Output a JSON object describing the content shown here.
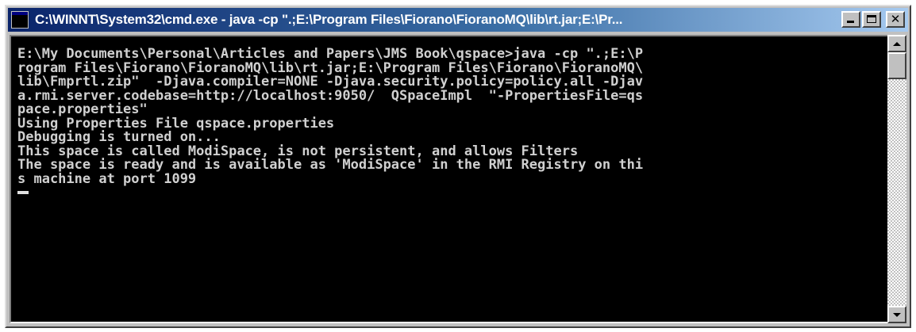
{
  "window": {
    "title": "C:\\WINNT\\System32\\cmd.exe - java -cp \".;E:\\Program Files\\Fiorano\\FioranoMQ\\lib\\rt.jar;E:\\Pr..."
  },
  "console": {
    "lines": [
      "E:\\My Documents\\Personal\\Articles and Papers\\JMS Book\\qspace>java -cp \".;E:\\P",
      "rogram Files\\Fiorano\\FioranoMQ\\lib\\rt.jar;E:\\Program Files\\Fiorano\\FioranoMQ\\",
      "lib\\Fmprtl.zip\"  -Djava.compiler=NONE -Djava.security.policy=policy.all -Djav",
      "a.rmi.server.codebase=http://localhost:9050/  QSpaceImpl  \"-PropertiesFile=qs",
      "pace.properties\"",
      "Using Properties File qspace.properties",
      "Debugging is turned on...",
      "This space is called ModiSpace, is not persistent, and allows Filters",
      "The space is ready and is available as 'ModiSpace' in the RMI Registry on thi",
      "s machine at port 1099"
    ]
  },
  "icons": {
    "app": "cmd-prompt-icon",
    "minimize": "minimize-icon",
    "maximize": "maximize-icon",
    "close": "close-icon",
    "scroll_up": "arrow-up-icon",
    "scroll_down": "arrow-down-icon"
  },
  "colors": {
    "titlebar_start": "#0a246a",
    "titlebar_end": "#a6caf0",
    "console_bg": "#000000",
    "console_text": "#d0d0d0"
  }
}
